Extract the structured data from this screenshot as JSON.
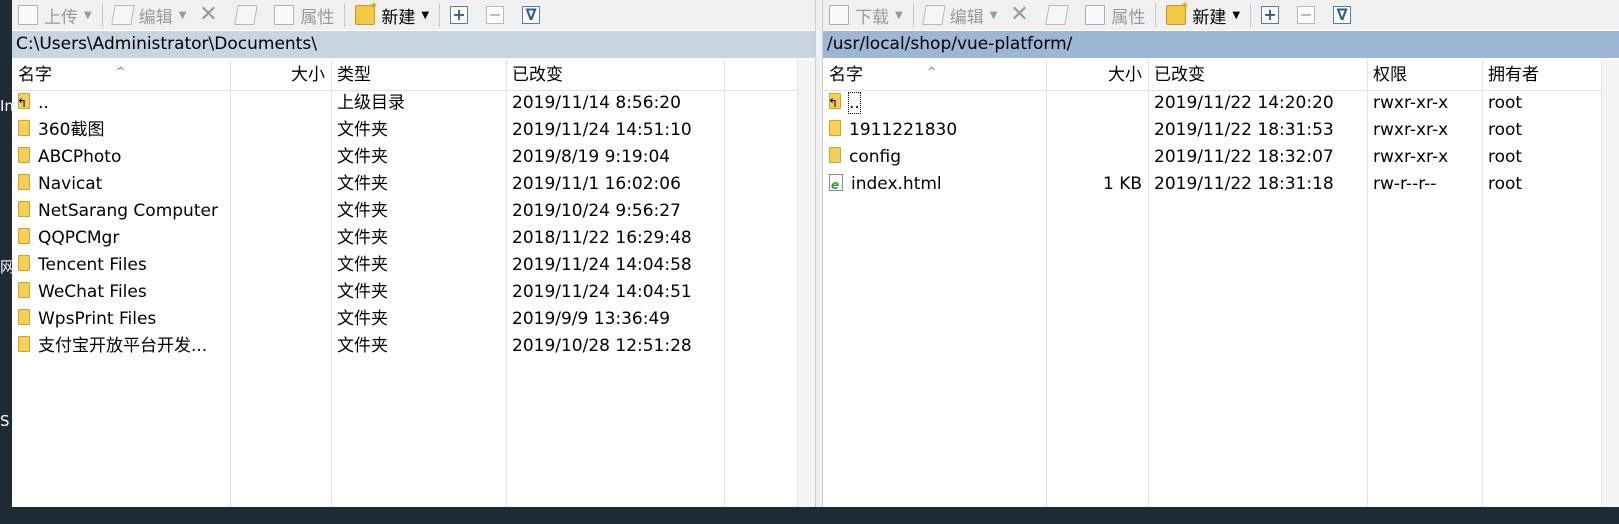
{
  "left_toolbar": {
    "upload": "上传",
    "edit": "编辑",
    "properties": "属性",
    "new": "新建"
  },
  "right_toolbar": {
    "download": "下载",
    "edit": "编辑",
    "properties": "属性",
    "new": "新建"
  },
  "icons": {
    "upload": "upload-icon",
    "download": "download-icon",
    "edit": "pencil-icon",
    "delete": "delete-x-icon",
    "rename": "rename-icon",
    "properties": "properties-icon",
    "new": "new-folder-icon",
    "plus": "plus-box-icon",
    "minus": "minus-box-icon",
    "filter": "filter-icon",
    "folder": "folder-icon",
    "parent": "parent-folder-icon",
    "html": "html-file-icon"
  },
  "left_pane": {
    "path": "C:\\Users\\Administrator\\Documents\\",
    "columns": {
      "name": "名字",
      "size": "大小",
      "type": "类型",
      "modified": "已改变"
    },
    "rows": [
      {
        "icon": "parent",
        "name": "..",
        "type": "上级目录",
        "modified": "2019/11/14  8:56:20"
      },
      {
        "icon": "folder",
        "name": "360截图",
        "type": "文件夹",
        "modified": "2019/11/24  14:51:10"
      },
      {
        "icon": "folder",
        "name": "ABCPhoto",
        "type": "文件夹",
        "modified": "2019/8/19  9:19:04"
      },
      {
        "icon": "folder",
        "name": "Navicat",
        "type": "文件夹",
        "modified": "2019/11/1  16:02:06"
      },
      {
        "icon": "folder",
        "name": "NetSarang Computer",
        "type": "文件夹",
        "modified": "2019/10/24  9:56:27"
      },
      {
        "icon": "folder",
        "name": "QQPCMgr",
        "type": "文件夹",
        "modified": "2018/11/22  16:29:48"
      },
      {
        "icon": "folder",
        "name": "Tencent Files",
        "type": "文件夹",
        "modified": "2019/11/24  14:04:58"
      },
      {
        "icon": "folder",
        "name": "WeChat Files",
        "type": "文件夹",
        "modified": "2019/11/24  14:04:51"
      },
      {
        "icon": "folder",
        "name": "WpsPrint Files",
        "type": "文件夹",
        "modified": "2019/9/9  13:36:49"
      },
      {
        "icon": "folder",
        "name": "支付宝开放平台开发...",
        "type": "文件夹",
        "modified": "2019/10/28  12:51:28"
      }
    ]
  },
  "right_pane": {
    "path": "/usr/local/shop/vue-platform/",
    "columns": {
      "name": "名字",
      "size": "大小",
      "modified": "已改变",
      "permissions": "权限",
      "owner": "拥有者"
    },
    "rows": [
      {
        "icon": "parent",
        "name": "..",
        "size": "",
        "modified": "2019/11/22 14:20:20",
        "permissions": "rwxr-xr-x",
        "owner": "root"
      },
      {
        "icon": "folder",
        "name": "1911221830",
        "size": "",
        "modified": "2019/11/22 18:31:53",
        "permissions": "rwxr-xr-x",
        "owner": "root"
      },
      {
        "icon": "folder",
        "name": "config",
        "size": "",
        "modified": "2019/11/22 18:32:07",
        "permissions": "rwxr-xr-x",
        "owner": "root"
      },
      {
        "icon": "html",
        "name": "index.html",
        "size": "1 KB",
        "modified": "2019/11/22 18:31:18",
        "permissions": "rw-r--r--",
        "owner": "root"
      }
    ]
  },
  "edge_glyphs": [
    "In",
    "网",
    "S"
  ]
}
